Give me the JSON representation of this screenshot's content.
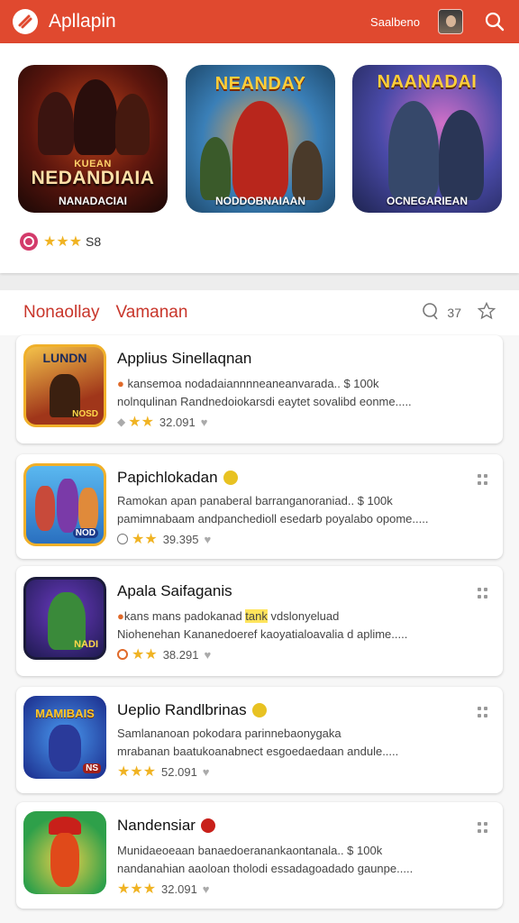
{
  "header": {
    "title": "Apllapin",
    "link": "Saalbeno",
    "colors": {
      "bar": "#e0492f"
    }
  },
  "featured": {
    "cards": [
      {
        "top": "KUEAN",
        "main": "NEDANDIAIA",
        "bottom": "NANADACIAI"
      },
      {
        "top": "NEANDAY",
        "bottom": "NODDOBNAIAAN"
      },
      {
        "top": "NAANADAI",
        "bottom": "OCNEGARIEAN"
      }
    ],
    "stars": "★★★",
    "rating": "S8"
  },
  "list": {
    "tab_primary": "Nonaollay",
    "tab_secondary": "Vamanan",
    "count": "37",
    "items": [
      {
        "title": "Applius Sinellaqnan",
        "icon_text": "LUNDN",
        "icon_sub": "NOSD",
        "desc1": "kansemoa nodadaiannnneaneanvarada..  $ 100k",
        "desc2": "nolnqulinan Randnedoiokarsdi eaytet sovalibd eonme.....",
        "stars": "★★",
        "score": "32.091"
      },
      {
        "title": "Papichlokadan",
        "icon_text": "",
        "icon_sub": "NOD",
        "desc1": "Ramokan apan panaberal barranganoraniad..  $ 100k",
        "desc2": "pamimnabaam andpanchedioll esedarb poyalabo opome.....",
        "stars": "★★",
        "score": "39.395"
      },
      {
        "title": "Apala Saifaganis",
        "icon_text": "",
        "icon_sub": "NADI",
        "desc1a": "kans mans padokanad ",
        "desc1b": "tank",
        "desc1c": " vdslonyeluad",
        "desc2": "Niohenehan Kananedoeref kaoyatialoavalia d aplime.....",
        "stars": "★★",
        "score": "38.291"
      },
      {
        "title": "Ueplio Randlbrinas",
        "icon_text": "MAMIBAIS",
        "icon_sub": "NS",
        "desc1": "Samlananoan pokodara parinnebaonygaka",
        "desc2": "mrabanan baatukoanabnect esgoedaedaan andule.....",
        "stars": "★★★",
        "score": "52.091"
      },
      {
        "title": "Nandensiar",
        "icon_text": "",
        "icon_sub": "",
        "desc1": "Munidaeoeaan banaedoeranankaontanala..  $ 100k",
        "desc2": "nandanahian aaoloan tholodi essadagoadado gaunpe.....",
        "stars": "★★★",
        "score": "32.091"
      }
    ]
  }
}
